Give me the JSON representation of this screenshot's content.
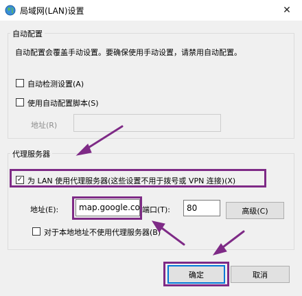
{
  "window": {
    "title": "局域网(LAN)设置",
    "close_glyph": "✕",
    "icon": "network-globe-icon"
  },
  "auto_config": {
    "group_title": "自动配置",
    "description": "自动配置会覆盖手动设置。要确保使用手动设置，请禁用自动配置。",
    "auto_detect_label": "自动检测设置(A)",
    "auto_detect_checked": false,
    "use_script_label": "使用自动配置脚本(S)",
    "use_script_checked": false,
    "address_label": "地址(R)",
    "address_value": ""
  },
  "proxy": {
    "group_title": "代理服务器",
    "use_proxy_label": "为 LAN 使用代理服务器(这些设置不用于拨号或 VPN 连接)(X)",
    "use_proxy_checked": true,
    "check_glyph": "✓",
    "address_label": "地址(E):",
    "address_value": "map.google.co",
    "port_label": "端口(T):",
    "port_value": "80",
    "advanced_label": "高级(C)",
    "bypass_local_label": "对于本地地址不使用代理服务器(B)",
    "bypass_local_checked": false
  },
  "footer": {
    "ok_label": "确定",
    "cancel_label": "取消"
  },
  "colors": {
    "annotation": "#7e2a86",
    "focus_border": "#0078d7"
  }
}
